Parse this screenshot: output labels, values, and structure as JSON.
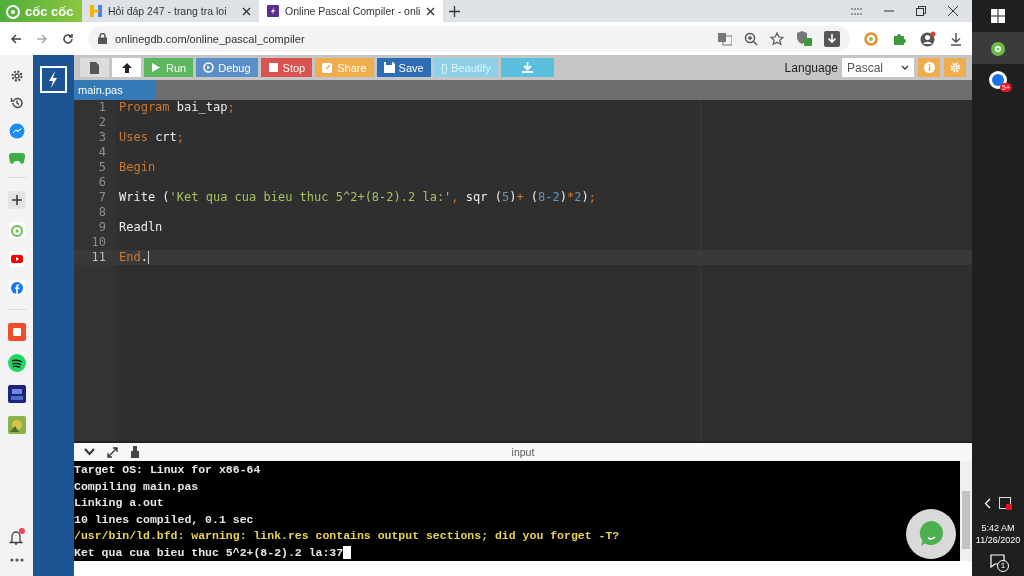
{
  "browser": {
    "logo": "cốc cốc",
    "tabs": [
      {
        "kind": "hoidap",
        "title": "Hỏi đáp 247 - trang tra loi",
        "selected": false
      },
      {
        "kind": "onlinegdb",
        "title": "Online Pascal Compiler - onli",
        "selected": true
      }
    ],
    "address": "onlinegdb.com/online_pascal_compiler"
  },
  "toolbar": {
    "buttons": [
      {
        "kind": "new_file",
        "color": "#dcdcdc",
        "disabled": false
      },
      {
        "kind": "upload",
        "color": "#ffffff",
        "disabled": false
      },
      {
        "kind": "run",
        "label": "Run",
        "color": "#5cb85c",
        "disabled": false
      },
      {
        "kind": "debug",
        "label": "Debug",
        "color": "#5b8fc9",
        "disabled": false
      },
      {
        "kind": "stop",
        "label": "Stop",
        "color": "#d9534f",
        "disabled": false
      },
      {
        "kind": "share",
        "label": "Share",
        "color": "#f0ad4e",
        "disabled": false
      },
      {
        "kind": "save",
        "label": "Save",
        "color": "#2d6db5",
        "disabled": false
      },
      {
        "kind": "beautify",
        "label": "{} Beautify",
        "color": "#8ccfe6",
        "disabled": true
      },
      {
        "kind": "download",
        "color": "#5bc0de",
        "disabled": false
      }
    ],
    "language_label": "Language",
    "language": "Pascal"
  },
  "file_tab": "main.pas",
  "editor": {
    "lines": [
      {
        "number": "1",
        "current": false,
        "tokens": [
          {
            "kind": "keyword",
            "text": "Program"
          },
          {
            "kind": "ident",
            "text": " bai_tap"
          },
          {
            "kind": "keyword",
            "text": ";"
          }
        ]
      },
      {
        "number": "2",
        "current": false
      },
      {
        "number": "3",
        "current": false,
        "tokens": [
          {
            "kind": "keyword",
            "text": "Uses"
          },
          {
            "kind": "ident",
            "text": " crt"
          },
          {
            "kind": "keyword",
            "text": ";"
          }
        ]
      },
      {
        "number": "4",
        "current": false
      },
      {
        "number": "5",
        "current": false,
        "tokens": [
          {
            "kind": "keyword",
            "text": "Begin"
          }
        ]
      },
      {
        "number": "6",
        "current": false
      },
      {
        "number": "7",
        "current": false,
        "tokens": [
          {
            "kind": "ident",
            "text": "Write ("
          },
          {
            "kind": "string",
            "text": "'Ket qua cua bieu thuc 5^2+(8-2).2 la:'"
          },
          {
            "kind": "keyword",
            "text": ","
          },
          {
            "kind": "ident",
            "text": " sqr ("
          },
          {
            "kind": "number",
            "text": "5"
          },
          {
            "kind": "ident",
            "text": ")"
          },
          {
            "kind": "keyword",
            "text": "+"
          },
          {
            "kind": "ident",
            "text": " ("
          },
          {
            "kind": "number",
            "text": "8-2"
          },
          {
            "kind": "ident",
            "text": ")"
          },
          {
            "kind": "keyword",
            "text": "*"
          },
          {
            "kind": "number",
            "text": "2"
          },
          {
            "kind": "ident",
            "text": ")"
          },
          {
            "kind": "keyword",
            "text": ";"
          }
        ]
      },
      {
        "number": "8",
        "current": false
      },
      {
        "number": "9",
        "current": false,
        "tokens": [
          {
            "kind": "ident",
            "text": "Readln"
          }
        ]
      },
      {
        "number": "10",
        "current": false
      },
      {
        "number": "11",
        "current": true,
        "tokens": [
          {
            "kind": "keyword",
            "text": "End"
          },
          {
            "kind": "ident",
            "text": "."
          }
        ]
      }
    ]
  },
  "output": {
    "header": "input",
    "cursor": true,
    "lines": [
      {
        "kind": "normal",
        "text": "Target OS: Linux for x86-64"
      },
      {
        "kind": "normal",
        "text": "Compiling main.pas"
      },
      {
        "kind": "normal",
        "text": "Linking a.out"
      },
      {
        "kind": "normal",
        "text": "10 lines compiled, 0.1 sec"
      },
      {
        "kind": "warning",
        "text": "/usr/bin/ld.bfd: warning: link.res contains output sections; did you forget -T?"
      },
      {
        "kind": "normal",
        "text": "Ket qua cua bieu thuc 5^2+(8-2).2 la:37"
      }
    ]
  },
  "taskbar": {
    "app_badge": "5+",
    "time": "5:42 AM",
    "date": "11/26/2020",
    "notifications": "1"
  }
}
